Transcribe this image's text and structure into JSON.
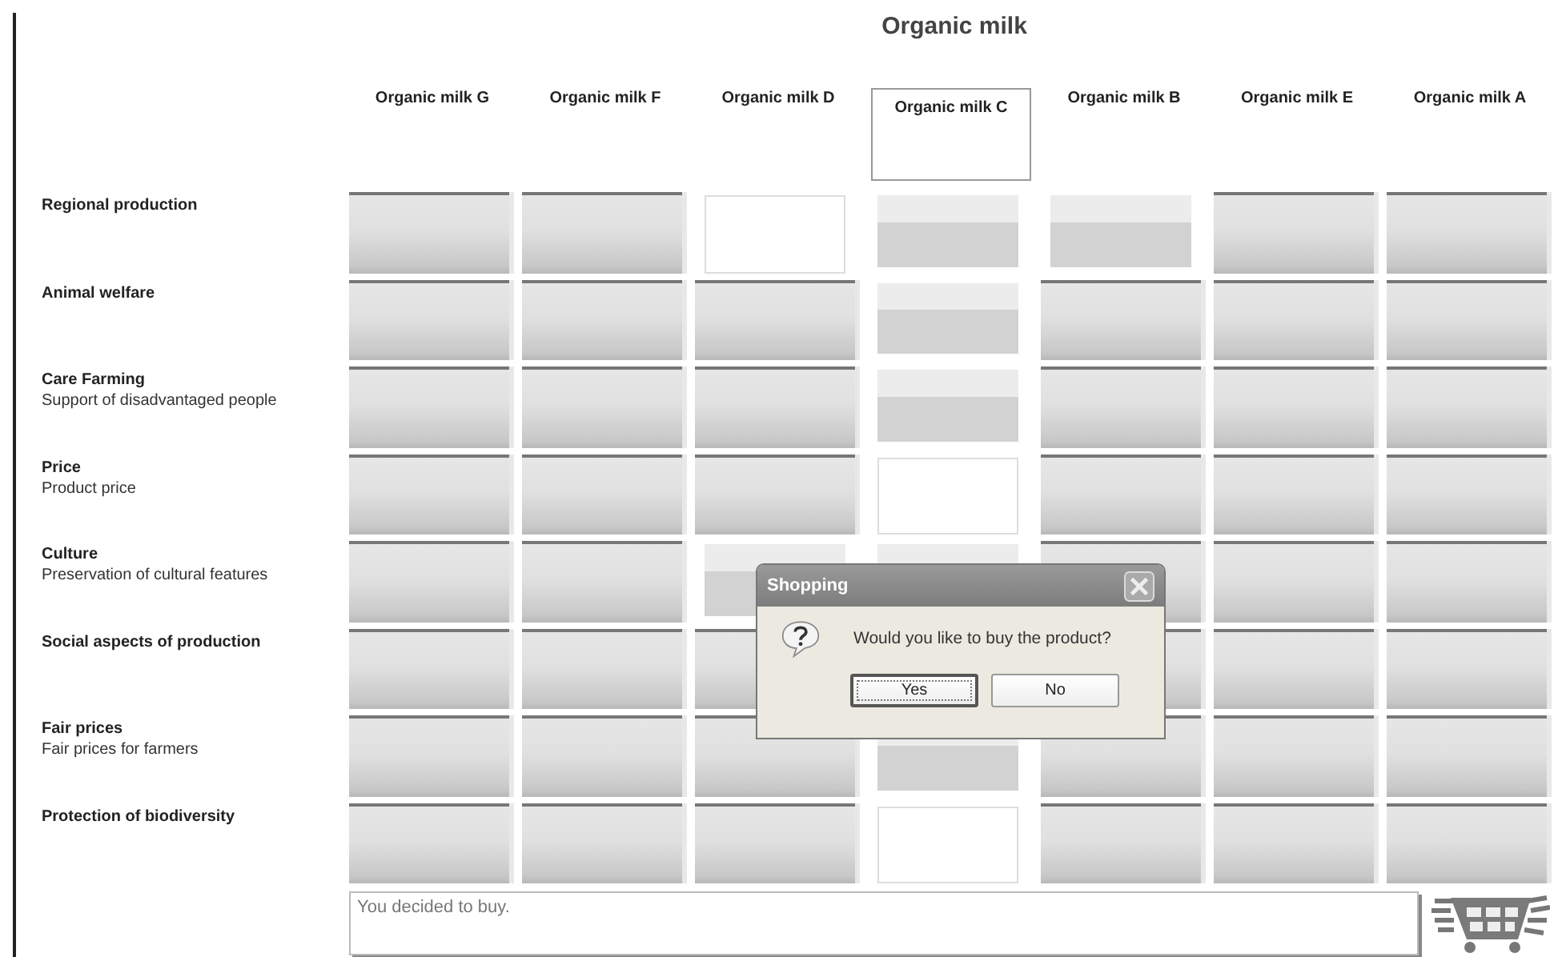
{
  "title": "Organic milk",
  "columns": [
    {
      "label": "Organic milk G",
      "selected": false
    },
    {
      "label": "Organic milk F",
      "selected": false
    },
    {
      "label": "Organic milk D",
      "selected": false
    },
    {
      "label": "Organic milk C",
      "selected": true
    },
    {
      "label": "Organic milk B",
      "selected": false
    },
    {
      "label": "Organic milk E",
      "selected": false
    },
    {
      "label": "Organic milk A",
      "selected": false
    }
  ],
  "rows": [
    {
      "name": "Regional production",
      "cells": [
        {
          "kind": "raised"
        },
        {
          "kind": "raised"
        },
        {
          "kind": "empty"
        },
        {
          "kind": "flat"
        },
        {
          "kind": "flat"
        },
        {
          "kind": "raised"
        },
        {
          "kind": "raised"
        }
      ]
    },
    {
      "name": "Animal welfare",
      "cells": [
        {
          "kind": "raised"
        },
        {
          "kind": "raised"
        },
        {
          "kind": "raised"
        },
        {
          "kind": "flat"
        },
        {
          "kind": "raised"
        },
        {
          "kind": "raised"
        },
        {
          "kind": "raised"
        }
      ]
    },
    {
      "name": "Care Farming",
      "description": "Support of disadvantaged people",
      "cells": [
        {
          "kind": "raised"
        },
        {
          "kind": "raised"
        },
        {
          "kind": "raised"
        },
        {
          "kind": "flat"
        },
        {
          "kind": "raised"
        },
        {
          "kind": "raised"
        },
        {
          "kind": "raised"
        }
      ]
    },
    {
      "name": "Price",
      "description": "Product price",
      "cells": [
        {
          "kind": "raised"
        },
        {
          "kind": "raised"
        },
        {
          "kind": "raised"
        },
        {
          "kind": "empty"
        },
        {
          "kind": "raised"
        },
        {
          "kind": "raised"
        },
        {
          "kind": "raised"
        }
      ]
    },
    {
      "name": "Culture",
      "description": "Preservation of cultural features",
      "cells": [
        {
          "kind": "raised"
        },
        {
          "kind": "raised"
        },
        {
          "kind": "flat"
        },
        {
          "kind": "flat"
        },
        {
          "kind": "raised"
        },
        {
          "kind": "raised"
        },
        {
          "kind": "raised"
        }
      ]
    },
    {
      "name": "Social aspects of production",
      "cells": [
        {
          "kind": "raised"
        },
        {
          "kind": "raised"
        },
        {
          "kind": "raised"
        },
        null,
        {
          "kind": "raised"
        },
        {
          "kind": "raised"
        },
        {
          "kind": "raised"
        }
      ]
    },
    {
      "name": "Fair prices",
      "description": "Fair prices for farmers",
      "cells": [
        {
          "kind": "raised"
        },
        {
          "kind": "raised"
        },
        {
          "kind": "raised"
        },
        {
          "kind": "flat"
        },
        {
          "kind": "raised"
        },
        {
          "kind": "raised"
        },
        {
          "kind": "raised"
        }
      ]
    },
    {
      "name": "Protection of biodiversity",
      "cells": [
        {
          "kind": "raised"
        },
        {
          "kind": "raised"
        },
        {
          "kind": "raised"
        },
        {
          "kind": "empty"
        },
        {
          "kind": "raised"
        },
        {
          "kind": "raised"
        },
        {
          "kind": "raised"
        }
      ]
    }
  ],
  "message_box": {
    "value": "You decided to buy."
  },
  "dialog": {
    "title": "Shopping",
    "message": "Would you like to buy the product?",
    "buttons": [
      {
        "label": "Yes",
        "selected": true
      },
      {
        "label": "No",
        "selected": false
      }
    ]
  }
}
